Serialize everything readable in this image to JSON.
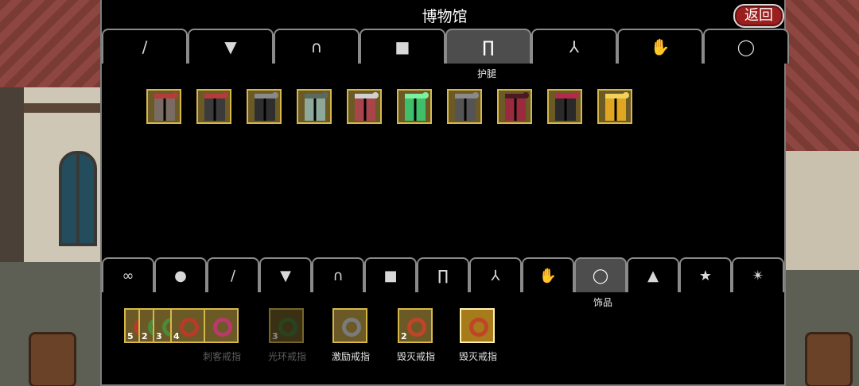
{
  "window": {
    "title": "博物馆",
    "back_label": "返回"
  },
  "top_tabs": [
    {
      "icon": "sword-icon",
      "glyph": "∕"
    },
    {
      "icon": "shield-icon",
      "glyph": "▼"
    },
    {
      "icon": "helmet-icon",
      "glyph": "∩"
    },
    {
      "icon": "armor-icon",
      "glyph": "■"
    },
    {
      "icon": "pants-icon",
      "glyph": "∏"
    },
    {
      "icon": "boots-icon",
      "glyph": "⅄"
    },
    {
      "icon": "glove-icon",
      "glyph": "✋"
    },
    {
      "icon": "ring-icon",
      "glyph": "◯"
    }
  ],
  "top_active_caption": "护腿",
  "leg_items": [
    {
      "color": "#7a6c62",
      "accent": "#b63b3b"
    },
    {
      "color": "#3b3b3b",
      "accent": "#b63b3b"
    },
    {
      "color": "#2f2f2f",
      "accent": "#8a8a8a"
    },
    {
      "color": "#8ea89a",
      "accent": "#5a6a60"
    },
    {
      "color": "#a8444a",
      "accent": "#d0d0d0"
    },
    {
      "color": "#3fbf6a",
      "accent": "#7cf0a0"
    },
    {
      "color": "#545454",
      "accent": "#8a8a8a"
    },
    {
      "color": "#9a2b3e",
      "accent": "#4b1a22"
    },
    {
      "color": "#2a2a2a",
      "accent": "#b52a4a"
    },
    {
      "color": "#e0a521",
      "accent": "#f2d25a"
    }
  ],
  "bottom_tabs": [
    {
      "icon": "infinity-icon",
      "glyph": "∞"
    },
    {
      "icon": "potion-icon",
      "glyph": "●"
    },
    {
      "icon": "sword-icon",
      "glyph": "∕"
    },
    {
      "icon": "shield-icon",
      "glyph": "▼"
    },
    {
      "icon": "helmet-icon",
      "glyph": "∩"
    },
    {
      "icon": "armor-icon",
      "glyph": "■"
    },
    {
      "icon": "pants-icon",
      "glyph": "∏"
    },
    {
      "icon": "boots-icon",
      "glyph": "⅄"
    },
    {
      "icon": "glove-icon",
      "glyph": "✋"
    },
    {
      "icon": "ring-icon",
      "glyph": "◯"
    },
    {
      "icon": "hat-icon",
      "glyph": "▲"
    },
    {
      "icon": "star-icon",
      "glyph": "★"
    },
    {
      "icon": "wand-icon",
      "glyph": "✴"
    }
  ],
  "bottom_active_caption": "饰品",
  "ring_items": [
    {
      "count": "5",
      "ring_color": "#b83a2a"
    },
    {
      "count": "2",
      "ring_color": "#4a8a3a"
    },
    {
      "count": "3",
      "ring_color": "#4a8a3a"
    },
    {
      "count": "4",
      "ring_color": "#b83a2a"
    },
    {
      "count": "",
      "ring_color": "#b83a6a"
    }
  ],
  "ring_groups": [
    {
      "label": "刺客戒指",
      "dim": true
    },
    {
      "label": "光环戒指",
      "dim": true,
      "count": "3",
      "ring_color": "#4a7a3a"
    },
    {
      "label": "激励戒指",
      "dim": false,
      "ring_color": "#7a7a7a"
    },
    {
      "label": "毁灭戒指",
      "dim": false,
      "count": "2",
      "ring_color": "#c04428"
    },
    {
      "label": "毁灭戒指",
      "dim": false,
      "ring_color": "#c04428"
    }
  ]
}
